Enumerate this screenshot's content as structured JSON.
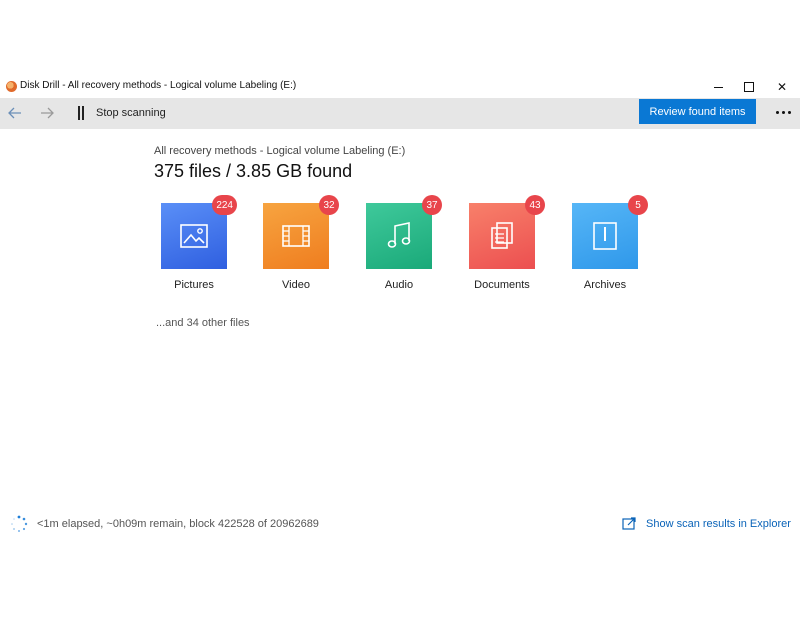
{
  "window": {
    "title": "Disk Drill - All recovery methods - Logical volume Labeling (E:)",
    "close_glyph": "✕"
  },
  "toolbar": {
    "stop_label": "Stop scanning",
    "review_label": "Review found items"
  },
  "main": {
    "breadcrumb": "All recovery methods - Logical volume Labeling (E:)",
    "headline": "375 files / 3.85 GB found",
    "categories": [
      {
        "label": "Pictures",
        "count": "224",
        "icon": "picture-icon"
      },
      {
        "label": "Video",
        "count": "32",
        "icon": "film-icon"
      },
      {
        "label": "Audio",
        "count": "37",
        "icon": "music-note-icon"
      },
      {
        "label": "Documents",
        "count": "43",
        "icon": "documents-icon"
      },
      {
        "label": "Archives",
        "count": "5",
        "icon": "archive-icon"
      }
    ],
    "other_files": "...and 34 other files"
  },
  "status": {
    "progress_text": "<1m elapsed, ~0h09m remain, block 422528 of 20962689",
    "explorer_link": "Show scan results in Explorer"
  },
  "colors": {
    "accent": "#0a78d4",
    "badge": "#e8454b",
    "pictures": "#3f73ee",
    "video": "#f39030",
    "audio": "#27b987",
    "documents": "#f2645b",
    "archives": "#40a6f1"
  }
}
